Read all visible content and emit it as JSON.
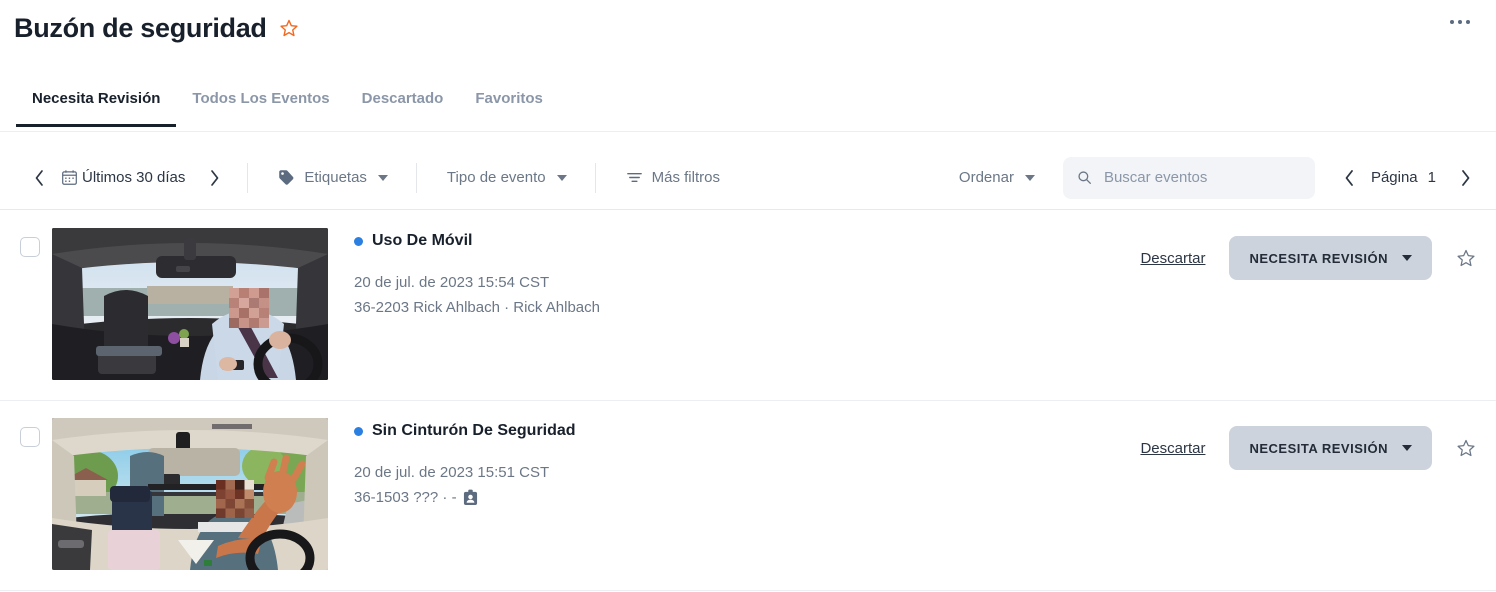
{
  "header": {
    "title": "Buzón de seguridad",
    "favorite_icon": "star-outline-icon",
    "favorite_color": "#f26a21",
    "overflow_label": "..."
  },
  "tabs": [
    {
      "label": "Necesita Revisión",
      "active": true
    },
    {
      "label": "Todos Los Eventos",
      "active": false
    },
    {
      "label": "Descartado",
      "active": false
    },
    {
      "label": "Favoritos",
      "active": false
    }
  ],
  "toolbar": {
    "date_range": "Últimos 30 días",
    "prev_range_icon": "chevron-left-icon",
    "next_range_icon": "chevron-right-icon",
    "calendar_icon": "calendar-icon",
    "tags_label": "Etiquetas",
    "tags_icon": "tag-icon",
    "event_type_label": "Tipo de evento",
    "more_filters_label": "Más filtros",
    "more_filters_icon": "filter-icon",
    "sort_label": "Ordenar",
    "search_placeholder": "Buscar eventos",
    "search_value": "",
    "search_icon": "search-icon",
    "page_label": "Página",
    "page_number": "1",
    "prev_page_icon": "chevron-left-icon",
    "next_page_icon": "chevron-right-icon"
  },
  "events": [
    {
      "title": "Uso De Móvil",
      "status_dot_color": "#2a7fe0",
      "timestamp": "20 de jul. de 2023 15:54 CST",
      "meta": "36-2203 Rick Ahlbach · Rick Ahlbach",
      "meta_has_badge_icon": false,
      "discard_label": "Descartar",
      "status_label": "NECESITA REVISIÓN",
      "star_icon": "star-outline-icon",
      "checkbox_checked": false,
      "thumbnail": "dashcam-interior-driver-phone"
    },
    {
      "title": "Sin Cinturón De Seguridad",
      "status_dot_color": "#2a7fe0",
      "timestamp": "20 de jul. de 2023 15:51 CST",
      "meta": "36-1503 ??? · -",
      "meta_has_badge_icon": true,
      "meta_badge_icon": "id-badge-icon",
      "discard_label": "Descartar",
      "status_label": "NECESITA REVISIÓN",
      "star_icon": "star-outline-icon",
      "checkbox_checked": false,
      "thumbnail": "dashcam-interior-driver-gesture"
    }
  ]
}
